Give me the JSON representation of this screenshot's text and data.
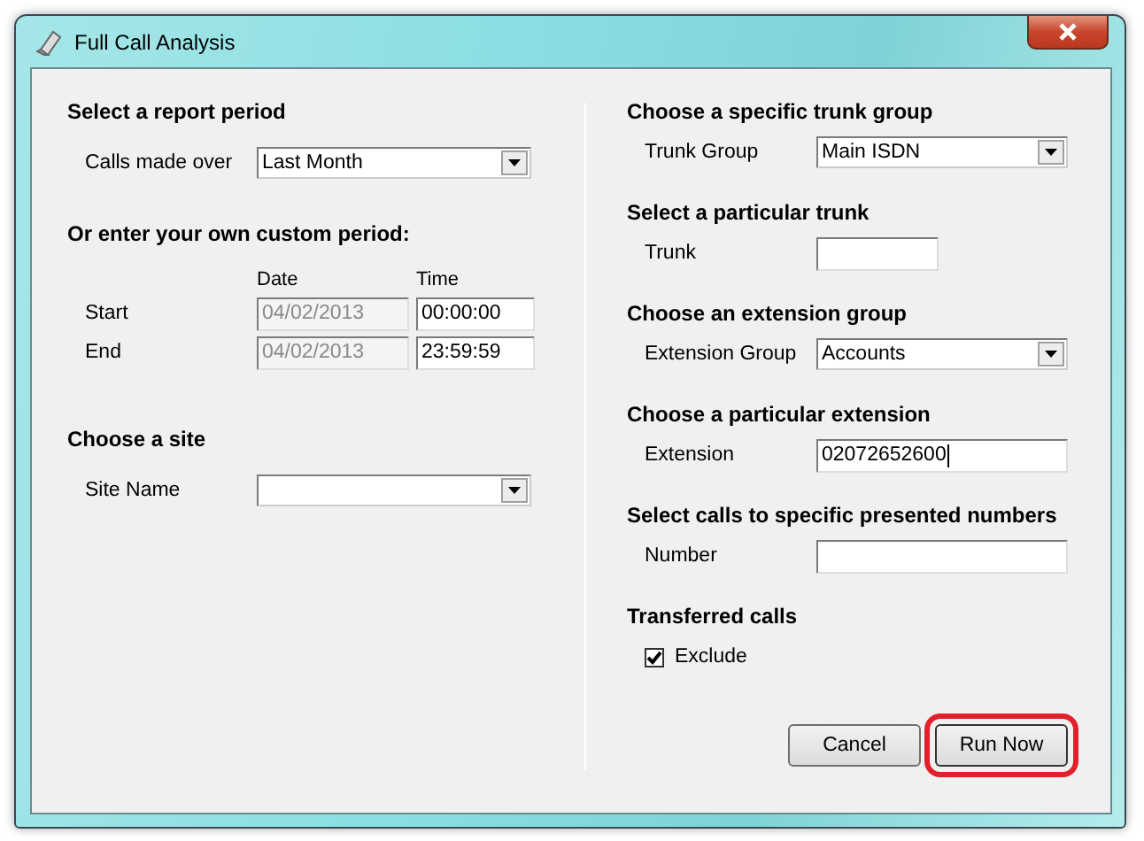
{
  "window": {
    "title": "Full Call Analysis"
  },
  "left": [
    {
      "heading": "Select a report period",
      "rows": [
        {
          "kind": "select",
          "label": "Calls made over",
          "value": "Last Month"
        }
      ]
    },
    {
      "heading": "Or enter your own custom period:",
      "columns": [
        "Date",
        "Time"
      ],
      "rows": [
        {
          "kind": "datetime",
          "label": "Start",
          "date": {
            "value": "04/02/2013",
            "disabled": true
          },
          "time": {
            "value": "00:00:00",
            "disabled": false
          }
        },
        {
          "kind": "datetime",
          "label": "End",
          "date": {
            "value": "04/02/2013",
            "disabled": true
          },
          "time": {
            "value": "23:59:59",
            "disabled": false
          }
        }
      ]
    },
    {
      "heading": "Choose a site",
      "rows": [
        {
          "kind": "select",
          "label": "Site Name",
          "value": ""
        }
      ]
    }
  ],
  "right": [
    {
      "heading": "Choose a specific trunk group",
      "rows": [
        {
          "kind": "select",
          "label": "Trunk Group",
          "value": "Main ISDN"
        }
      ]
    },
    {
      "heading": "Select a particular trunk",
      "rows": [
        {
          "kind": "short_input",
          "label": "Trunk",
          "value": "",
          "focused": false
        }
      ]
    },
    {
      "heading": "Choose an extension group",
      "rows": [
        {
          "kind": "select",
          "label": "Extension Group",
          "value": "Accounts"
        }
      ]
    },
    {
      "heading": "Choose a particular extension",
      "rows": [
        {
          "kind": "input",
          "label": "Extension",
          "value": "02072652600",
          "focused": true
        }
      ]
    },
    {
      "heading": "Select calls to specific presented numbers",
      "rows": [
        {
          "kind": "input",
          "label": "Number",
          "value": "",
          "focused": false
        }
      ]
    },
    {
      "heading": "Transferred calls",
      "rows": [
        {
          "kind": "checkbox",
          "label": "Exclude",
          "checked": true
        }
      ]
    }
  ],
  "buttons": [
    {
      "label": "Cancel",
      "highlighted": false
    },
    {
      "label": "Run Now",
      "highlighted": true
    }
  ]
}
